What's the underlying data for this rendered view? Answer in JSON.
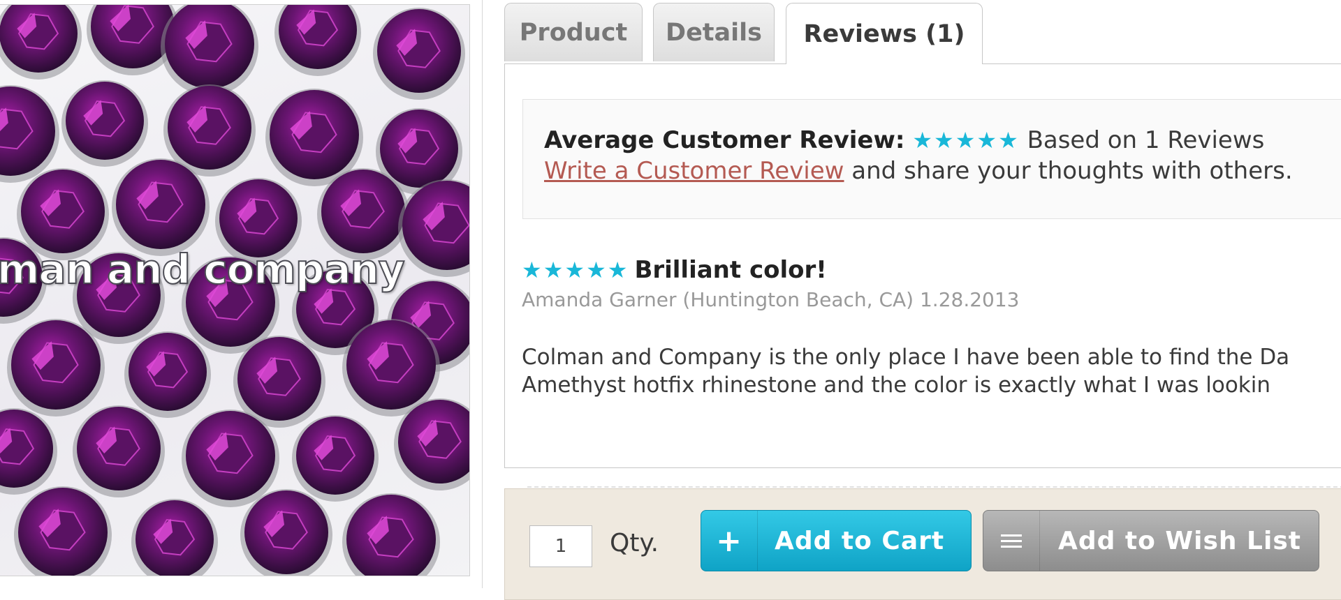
{
  "image": {
    "watermark": "man and company"
  },
  "tabs": [
    {
      "label": "Product"
    },
    {
      "label": "Details"
    },
    {
      "label": "Reviews (1)"
    }
  ],
  "summary": {
    "heading": "Average Customer Review:",
    "rating_stars": "★★★★★",
    "rating": 5,
    "based_on": "Based on 1 Reviews",
    "write_link": "Write a Customer Review",
    "write_suffix": " and share your thoughts with others."
  },
  "review": {
    "stars": "★★★★★",
    "rating": 5,
    "title": "Brilliant color!",
    "author_line": "Amanda Garner (Huntington Beach, CA) 1.28.2013",
    "body_line1": "Colman and Company is the only place I have been able to find the Da",
    "body_line2": "Amethyst hotfix rhinestone and the color is exactly what I was lookin"
  },
  "cart": {
    "qty_value": "1",
    "qty_label": "Qty.",
    "add_to_cart": "Add to Cart",
    "add_to_cart_icon": "plus-icon",
    "add_to_wishlist": "Add to Wish List",
    "add_to_wishlist_icon": "list-icon"
  },
  "colors": {
    "star": "#19b7d8",
    "link": "#b45a52",
    "cart_button": "#17acce",
    "wishlist_button": "#9e9e9e",
    "cart_bar_bg": "#efe9df"
  }
}
